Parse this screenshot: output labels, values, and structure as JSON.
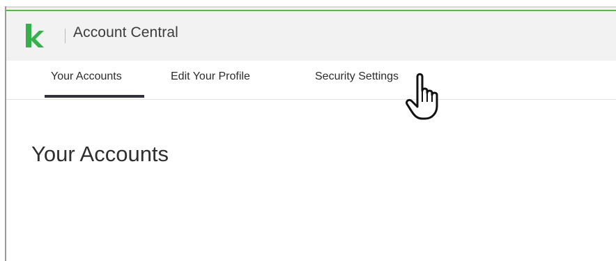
{
  "header": {
    "app_title": "Account Central",
    "logo_name": "keap-logo",
    "accent_color": "#4fbf3a"
  },
  "tabs": [
    {
      "label": "Your Accounts",
      "active": true
    },
    {
      "label": "Edit Your Profile",
      "active": false
    },
    {
      "label": "Security Settings",
      "active": false,
      "hovered": true
    }
  ],
  "main": {
    "page_title": "Your Accounts"
  },
  "cursor": {
    "type": "hand-pointer-icon"
  }
}
